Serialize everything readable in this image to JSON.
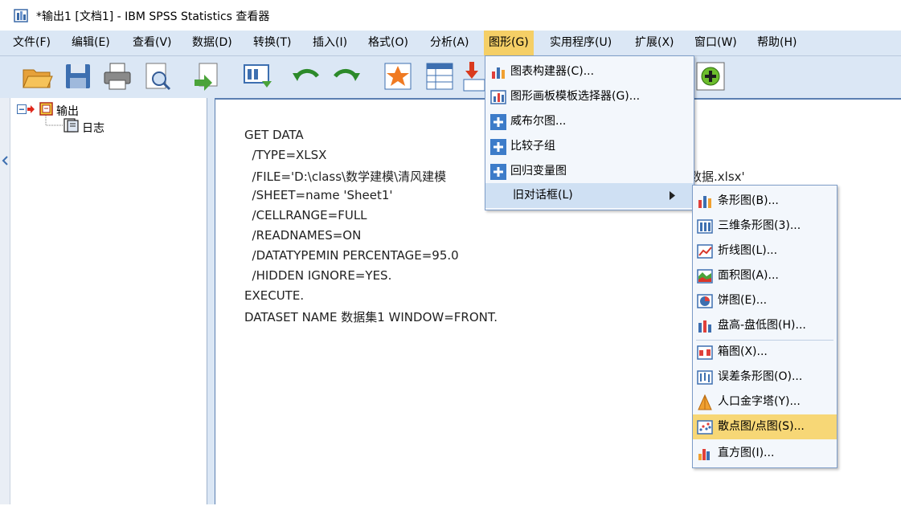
{
  "window": {
    "title": "*输出1 [文档1] - IBM SPSS Statistics 查看器"
  },
  "menubar": [
    {
      "label": "文件(F)",
      "name": "file"
    },
    {
      "label": "编辑(E)",
      "name": "edit"
    },
    {
      "label": "查看(V)",
      "name": "view"
    },
    {
      "label": "数据(D)",
      "name": "data"
    },
    {
      "label": "转换(T)",
      "name": "transform"
    },
    {
      "label": "插入(I)",
      "name": "insert"
    },
    {
      "label": "格式(O)",
      "name": "format"
    },
    {
      "label": "分析(A)",
      "name": "analyze"
    },
    {
      "label": "图形(G)",
      "name": "graphs",
      "active": true
    },
    {
      "label": "实用程序(U)",
      "name": "utilities"
    },
    {
      "label": "扩展(X)",
      "name": "extensions"
    },
    {
      "label": "窗口(W)",
      "name": "window"
    },
    {
      "label": "帮助(H)",
      "name": "help"
    }
  ],
  "toolbar_icons": [
    "open-icon",
    "save-icon",
    "print-icon",
    "print-preview-icon",
    "export-icon",
    "goto-data-icon",
    "undo-icon",
    "redo-icon",
    "goto-case-icon",
    "goto-variable-icon",
    "insert-output-icon",
    "add-icon"
  ],
  "tree": {
    "root": "输出",
    "child": "日志"
  },
  "syntax_lines": [
    "GET DATA",
    "  /TYPE=XLSX",
    "  /FILE='D:\\class\\数学建模\\清风建模",
    "  /SHEET=name 'Sheet1'",
    "  /CELLRANGE=FULL",
    "  /READNAMES=ON",
    "  /DATATYPEMIN PERCENTAGE=95.0",
    "  /HIDDEN IGNORE=YES.",
    "EXECUTE.",
    "DATASET NAME 数据集1 WINDOW=FRONT."
  ],
  "syntax_file_tail": "数据.xlsx'",
  "graphs_menu": [
    {
      "label": "图表构建器(C)...",
      "icon": "chart-builder-icon"
    },
    {
      "label": "图形画板模板选择器(G)...",
      "icon": "template-chooser-icon"
    },
    {
      "label": "威布尔图...",
      "icon": "plus-icon"
    },
    {
      "label": "比较子组",
      "icon": "plus-icon"
    },
    {
      "label": "回归变量图",
      "icon": "plus-icon"
    },
    {
      "label": "旧对话框(L)",
      "icon": "",
      "submenu": true
    }
  ],
  "legacy_submenu": [
    {
      "label": "条形图(B)...",
      "icon": "bar-chart-icon"
    },
    {
      "label": "三维条形图(3)...",
      "icon": "3d-bar-chart-icon"
    },
    {
      "label": "折线图(L)...",
      "icon": "line-chart-icon"
    },
    {
      "label": "面积图(A)...",
      "icon": "area-chart-icon"
    },
    {
      "label": "饼图(E)...",
      "icon": "pie-chart-icon"
    },
    {
      "label": "盘高-盘低图(H)...",
      "icon": "high-low-chart-icon"
    },
    {
      "label": "箱图(X)...",
      "icon": "boxplot-icon"
    },
    {
      "label": "误差条形图(O)...",
      "icon": "error-bar-icon"
    },
    {
      "label": "人口金字塔(Y)...",
      "icon": "population-pyramid-icon"
    },
    {
      "label": "散点图/点图(S)...",
      "icon": "scatter-plot-icon"
    },
    {
      "label": "直方图(I)...",
      "icon": "histogram-icon"
    }
  ],
  "colors": {
    "menubar": "#dbe7f5",
    "highlight": "#f7d776",
    "accent": "#5b7fb1"
  }
}
